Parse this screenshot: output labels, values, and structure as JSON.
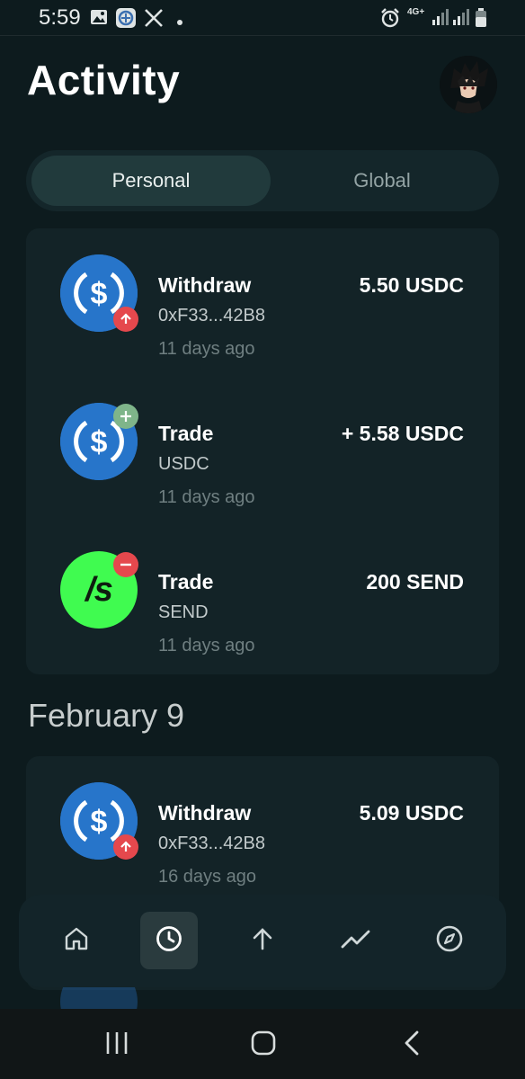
{
  "status_bar": {
    "time": "5:59",
    "icons": [
      "image-icon",
      "app-icon",
      "x-icon",
      "dot-icon",
      "alarm-icon",
      "4g-icon",
      "signal-icon",
      "signal-icon",
      "battery-icon"
    ],
    "network": "4G+"
  },
  "header": {
    "title": "Activity",
    "avatar": "avatar"
  },
  "tabs": [
    {
      "label": "Personal",
      "active": true
    },
    {
      "label": "Global",
      "active": false
    }
  ],
  "activity_groups": [
    {
      "heading": "",
      "items": [
        {
          "token": "usdc",
          "badge": "arrow-up-icon",
          "badge_color": "#e5484d",
          "title": "Withdraw",
          "subtitle": "0xF33...42B8",
          "time": "11 days ago",
          "amount": "5.50 USDC"
        },
        {
          "token": "usdc",
          "badge": "plus-icon",
          "badge_color": "#7fb58a",
          "title": "Trade",
          "subtitle": "USDC",
          "time": "11 days ago",
          "amount": "+ 5.58 USDC"
        },
        {
          "token": "send",
          "token_label": "/s",
          "badge": "minus-icon",
          "badge_color": "#e5484d",
          "title": "Trade",
          "subtitle": "SEND",
          "time": "11 days ago",
          "amount": "200 SEND"
        }
      ]
    },
    {
      "heading": "February 9",
      "items": [
        {
          "token": "usdc",
          "badge": "arrow-up-icon",
          "badge_color": "#e5484d",
          "title": "Withdraw",
          "subtitle": "0xF33...42B8",
          "time": "16 days ago",
          "amount": "5.09 USDC"
        }
      ]
    }
  ],
  "bottom_nav": [
    {
      "icon": "home-icon",
      "active": false
    },
    {
      "icon": "clock-icon",
      "active": true
    },
    {
      "icon": "arrow-up-icon",
      "active": false
    },
    {
      "icon": "trend-icon",
      "active": false
    },
    {
      "icon": "compass-icon",
      "active": false
    }
  ],
  "system_nav": [
    "recents-icon",
    "home-icon",
    "back-icon"
  ],
  "colors": {
    "background": "#0d1b1e",
    "card": "#132327",
    "usdc_blue": "#2775ca",
    "send_green": "#40fb50",
    "badge_red": "#e5484d",
    "badge_green": "#7fb58a"
  }
}
